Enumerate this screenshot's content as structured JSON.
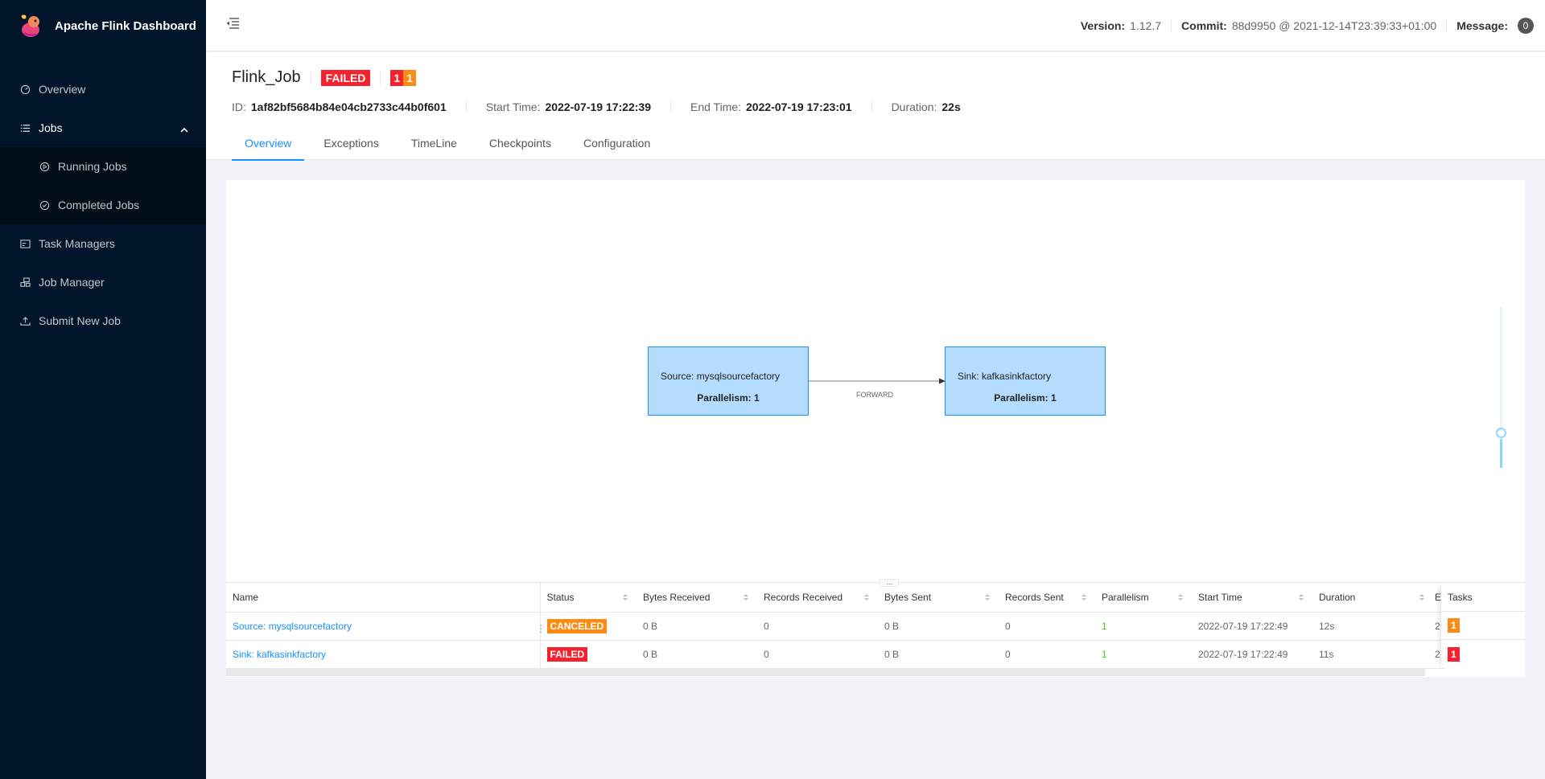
{
  "app": {
    "title": "Apache Flink Dashboard"
  },
  "sidebar": {
    "items": [
      {
        "label": "Overview"
      },
      {
        "label": "Jobs"
      },
      {
        "label": "Running Jobs"
      },
      {
        "label": "Completed Jobs"
      },
      {
        "label": "Task Managers"
      },
      {
        "label": "Job Manager"
      },
      {
        "label": "Submit New Job"
      }
    ]
  },
  "header": {
    "version_label": "Version:",
    "version_value": "1.12.7",
    "commit_label": "Commit:",
    "commit_value": "88d9950 @ 2021-12-14T23:39:33+01:00",
    "message_label": "Message:",
    "message_count": "0"
  },
  "job": {
    "name": "Flink_Job",
    "status": "FAILED",
    "count_failed": "1",
    "count_canceled": "1",
    "id_label": "ID:",
    "id_value": "1af82bf5684b84e04cb2733c44b0f601",
    "start_label": "Start Time:",
    "start_value": "2022-07-19 17:22:39",
    "end_label": "End Time:",
    "end_value": "2022-07-19 17:23:01",
    "duration_label": "Duration:",
    "duration_value": "22s"
  },
  "tabs": [
    {
      "label": "Overview"
    },
    {
      "label": "Exceptions"
    },
    {
      "label": "TimeLine"
    },
    {
      "label": "Checkpoints"
    },
    {
      "label": "Configuration"
    }
  ],
  "graph": {
    "source_name": "Source: mysqlsourcefactory",
    "source_parallelism": "Parallelism: 1",
    "sink_name": "Sink: kafkasinkfactory",
    "sink_parallelism": "Parallelism: 1",
    "edge_label": "FORWARD"
  },
  "table": {
    "headers": {
      "name": "Name",
      "status": "Status",
      "bytes_received": "Bytes Received",
      "records_received": "Records Received",
      "bytes_sent": "Bytes Sent",
      "records_sent": "Records Sent",
      "parallelism": "Parallelism",
      "start_time": "Start Time",
      "duration": "Duration",
      "end_time_truncated": "E",
      "tasks": "Tasks"
    },
    "rows": [
      {
        "name": "Source: mysqlsourcefactory",
        "status": "CANCELED",
        "bytes_received": "0 B",
        "records_received": "0",
        "bytes_sent": "0 B",
        "records_sent": "0",
        "parallelism": "1",
        "start_time": "2022-07-19 17:22:49",
        "duration": "12s",
        "end_time_truncated": "2",
        "tasks": "1"
      },
      {
        "name": "Sink: kafkasinkfactory",
        "status": "FAILED",
        "bytes_received": "0 B",
        "records_received": "0",
        "bytes_sent": "0 B",
        "records_sent": "0",
        "parallelism": "1",
        "start_time": "2022-07-19 17:22:49",
        "duration": "11s",
        "end_time_truncated": "2",
        "tasks": "1"
      }
    ]
  },
  "colors": {
    "sidebar_bg": "#001529",
    "accent": "#1890ff",
    "failed": "#f5222d",
    "canceled": "#fa8c16",
    "node_fill": "#b3dcff"
  }
}
